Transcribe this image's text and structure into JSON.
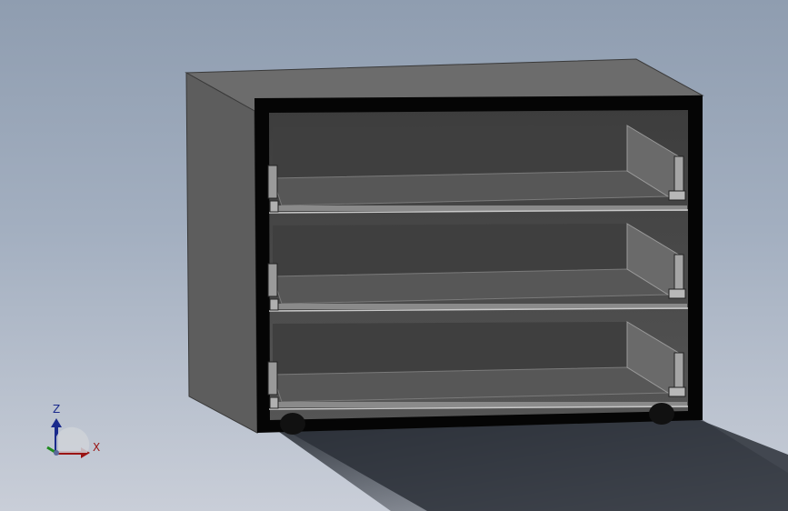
{
  "viewport": {
    "background_top": "#8f9db0",
    "background_bottom": "#c9ced8"
  },
  "model": {
    "body_color": "#6f6f6f",
    "top_color": "#6c6c6c",
    "side_color": "#5f5f5f",
    "frame_color": "#000000",
    "interior_color": "#4a4a4a",
    "drawer_count": 3
  },
  "triad": {
    "z_label": "Z",
    "x_label": "X",
    "z_color": "#1a2a8c",
    "x_color": "#9a1414",
    "y_color": "#1f8a1f"
  }
}
